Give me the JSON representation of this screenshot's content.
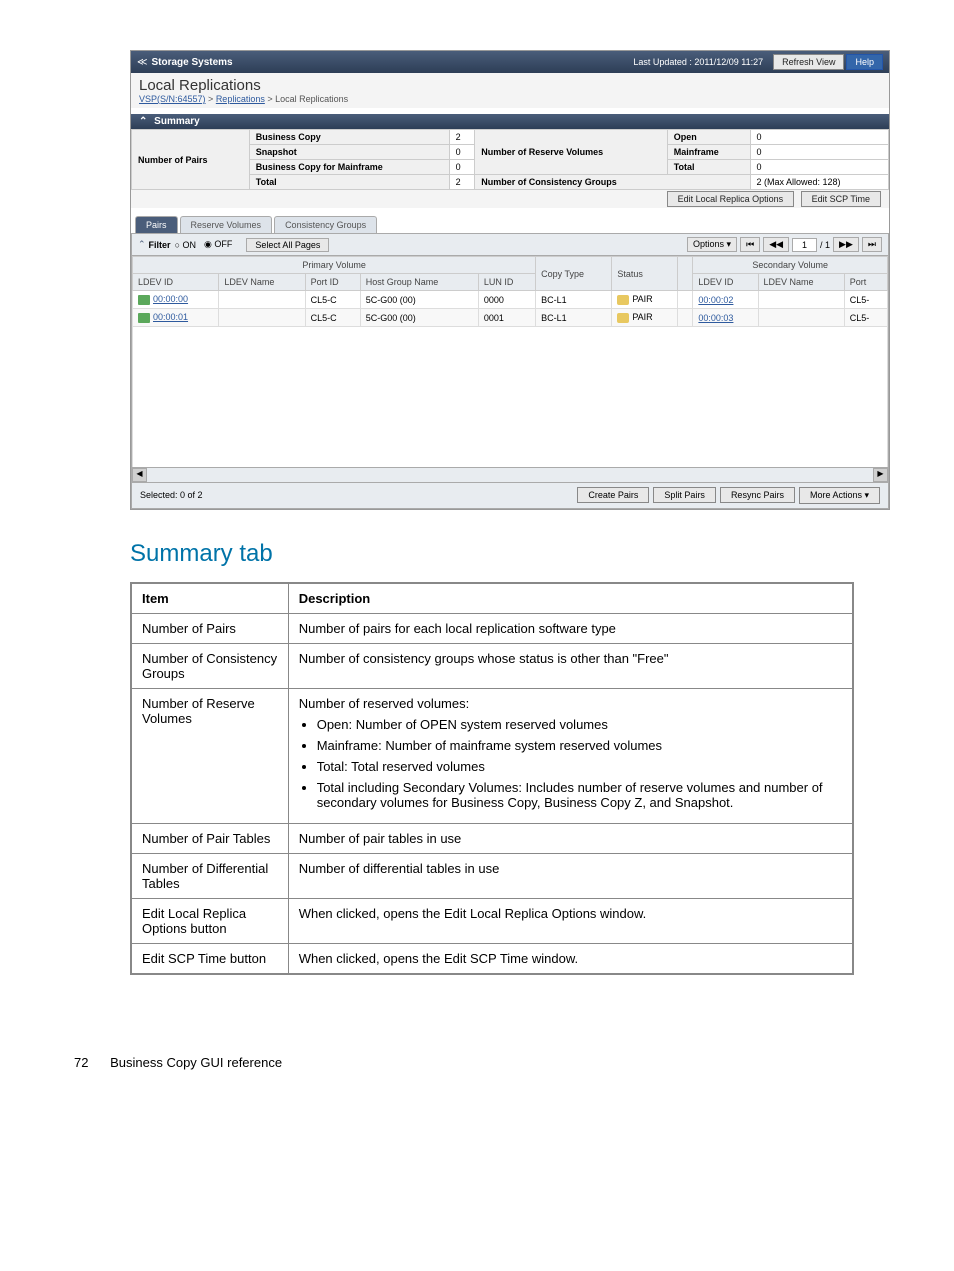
{
  "screenshot": {
    "titlebar": {
      "chev": "≪",
      "title": "Storage Systems",
      "updated": "Last Updated : 2011/12/09 11:27",
      "refresh": "Refresh View",
      "help": "Help"
    },
    "header": {
      "title": "Local Replications",
      "crumb_link1": "VSP(S/N:64557)",
      "crumb_sep1": " > ",
      "crumb_link2": "Replications",
      "crumb_sep2": " > Local Replications"
    },
    "summary_label": "Summary",
    "summary": {
      "numpairs": "Number of Pairs",
      "bc": "Business Copy",
      "bc_v": "2",
      "snap": "Snapshot",
      "snap_v": "0",
      "bcmf": "Business Copy for Mainframe",
      "bcmf_v": "0",
      "total": "Total",
      "total_v": "2",
      "numresv": "Number of Reserve Volumes",
      "open": "Open",
      "open_v": "0",
      "mf": "Mainframe",
      "mf_v": "0",
      "rtotal": "Total",
      "rtotal_v": "0",
      "numcg": "Number of Consistency Groups",
      "numcg_v": "2 (Max Allowed: 128)",
      "btn_edit_opts": "Edit Local Replica Options",
      "btn_edit_scp": "Edit SCP Time"
    },
    "tabs": {
      "t1": "Pairs",
      "t2": "Reserve Volumes",
      "t3": "Consistency Groups"
    },
    "filter": {
      "label": "Filter",
      "on": "ON",
      "off": "OFF",
      "selectall": "Select All Pages",
      "options": "Options ▾",
      "page": "1",
      "pageof": "/ 1"
    },
    "grid": {
      "primary": "Primary Volume",
      "secondary": "Secondary Volume",
      "ldevid": "LDEV ID",
      "ldevname": "LDEV Name",
      "portid": "Port ID",
      "hgn": "Host Group Name",
      "lunid": "LUN ID",
      "copytype": "Copy Type",
      "status": "Status",
      "blank": "",
      "ldevid2": "LDEV ID",
      "ldevname2": "LDEV Name",
      "port2": "Port",
      "rows": [
        {
          "ldev": "00:00:00",
          "ln": "",
          "port": "CL5-C",
          "hg": "5C-G00 (00)",
          "lun": "0000",
          "ct": "BC-L1",
          "st": "PAIR",
          "sldev": "00:00:02",
          "sln": "",
          "sp": "CL5-"
        },
        {
          "ldev": "00:00:01",
          "ln": "",
          "port": "CL5-C",
          "hg": "5C-G00 (00)",
          "lun": "0001",
          "ct": "BC-L1",
          "st": "PAIR",
          "sldev": "00:00:03",
          "sln": "",
          "sp": "CL5-"
        }
      ]
    },
    "footer": {
      "selected": "Selected: 0   of 2",
      "create": "Create Pairs",
      "split": "Split Pairs",
      "resync": "Resync Pairs",
      "more": "More Actions ▾"
    }
  },
  "doc": {
    "heading": "Summary tab",
    "th_item": "Item",
    "th_desc": "Description",
    "rows": [
      {
        "item": "Number of Pairs",
        "desc": "Number of pairs for each local replication software type"
      },
      {
        "item": "Number of Consistency Groups",
        "desc": "Number of consistency groups whose status is other than \"Free\""
      }
    ],
    "row3": {
      "item": "Number of Reserve Volumes",
      "intro": "Number of reserved volumes:",
      "b1": "Open: Number of OPEN system reserved volumes",
      "b2": "Mainframe: Number of mainframe system reserved volumes",
      "b3": "Total: Total reserved volumes",
      "b4": "Total including Secondary Volumes: Includes number of reserve volumes and number of secondary volumes for Business Copy, Business Copy Z, and Snapshot."
    },
    "rows2": [
      {
        "item": "Number of Pair Tables",
        "desc": "Number of pair tables in use"
      },
      {
        "item": "Number of Differential Tables",
        "desc": "Number of differential tables in use"
      },
      {
        "item": "Edit Local Replica Options button",
        "desc": "When clicked, opens the Edit Local Replica Options window."
      },
      {
        "item": "Edit SCP Time button",
        "desc": "When clicked, opens the Edit SCP Time window."
      }
    ]
  },
  "pagefooter": {
    "num": "72",
    "text": "Business Copy GUI reference"
  }
}
